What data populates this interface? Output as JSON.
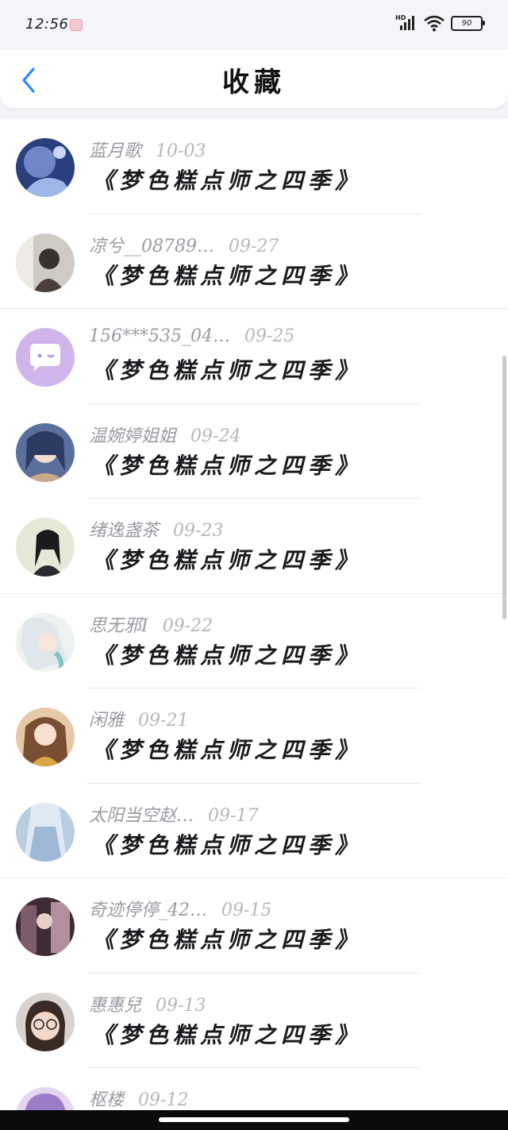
{
  "status_bar": {
    "time": "12:56",
    "signal_label": "HD",
    "battery": "90"
  },
  "header": {
    "title": "收藏"
  },
  "colors": {
    "accent": "#2a8cf0",
    "meta_text": "#9a9aa2",
    "book_text": "#1b1b1f"
  },
  "icons": {
    "back": "chevron-left-icon",
    "wifi": "wifi-icon",
    "signal": "signal-icon",
    "battery": "battery-icon"
  },
  "list": {
    "items": [
      {
        "name": "蓝月歌",
        "date": "10-03",
        "book": "《梦色糕点师之四季》",
        "avatar": "anime-blue-avatar"
      },
      {
        "name": "凉兮__08789…",
        "date": "09-27",
        "book": "《梦色糕点师之四季》",
        "avatar": "girl-photo-avatar"
      },
      {
        "name": "156***535_04…",
        "date": "09-25",
        "book": "《梦色糕点师之四季》",
        "avatar": "default-chat-avatar"
      },
      {
        "name": "温婉婷姐姐",
        "date": "09-24",
        "book": "《梦色糕点师之四季》",
        "avatar": "anime-girl-avatar"
      },
      {
        "name": "绪逸盏茶",
        "date": "09-23",
        "book": "《梦色糕点师之四季》",
        "avatar": "girl-outdoor-avatar"
      },
      {
        "name": "思无邪I",
        "date": "09-22",
        "book": "《梦色糕点师之四季》",
        "avatar": "anime-white-hair-avatar"
      },
      {
        "name": "闲雅",
        "date": "09-21",
        "book": "《梦色糕点师之四季》",
        "avatar": "anime-brown-hair-avatar"
      },
      {
        "name": "太阳当空赵…",
        "date": "09-17",
        "book": "《梦色糕点师之四季》",
        "avatar": "hanfu-avatar"
      },
      {
        "name": "奇迹停停_42…",
        "date": "09-15",
        "book": "《梦色糕点师之四季》",
        "avatar": "anime-scene-avatar"
      },
      {
        "name": "惠惠兒",
        "date": "09-13",
        "book": "《梦色糕点师之四季》",
        "avatar": "glasses-girl-avatar"
      },
      {
        "name": "枢楼",
        "date": "09-12",
        "book": "",
        "avatar": "purple-hair-avatar"
      }
    ]
  }
}
